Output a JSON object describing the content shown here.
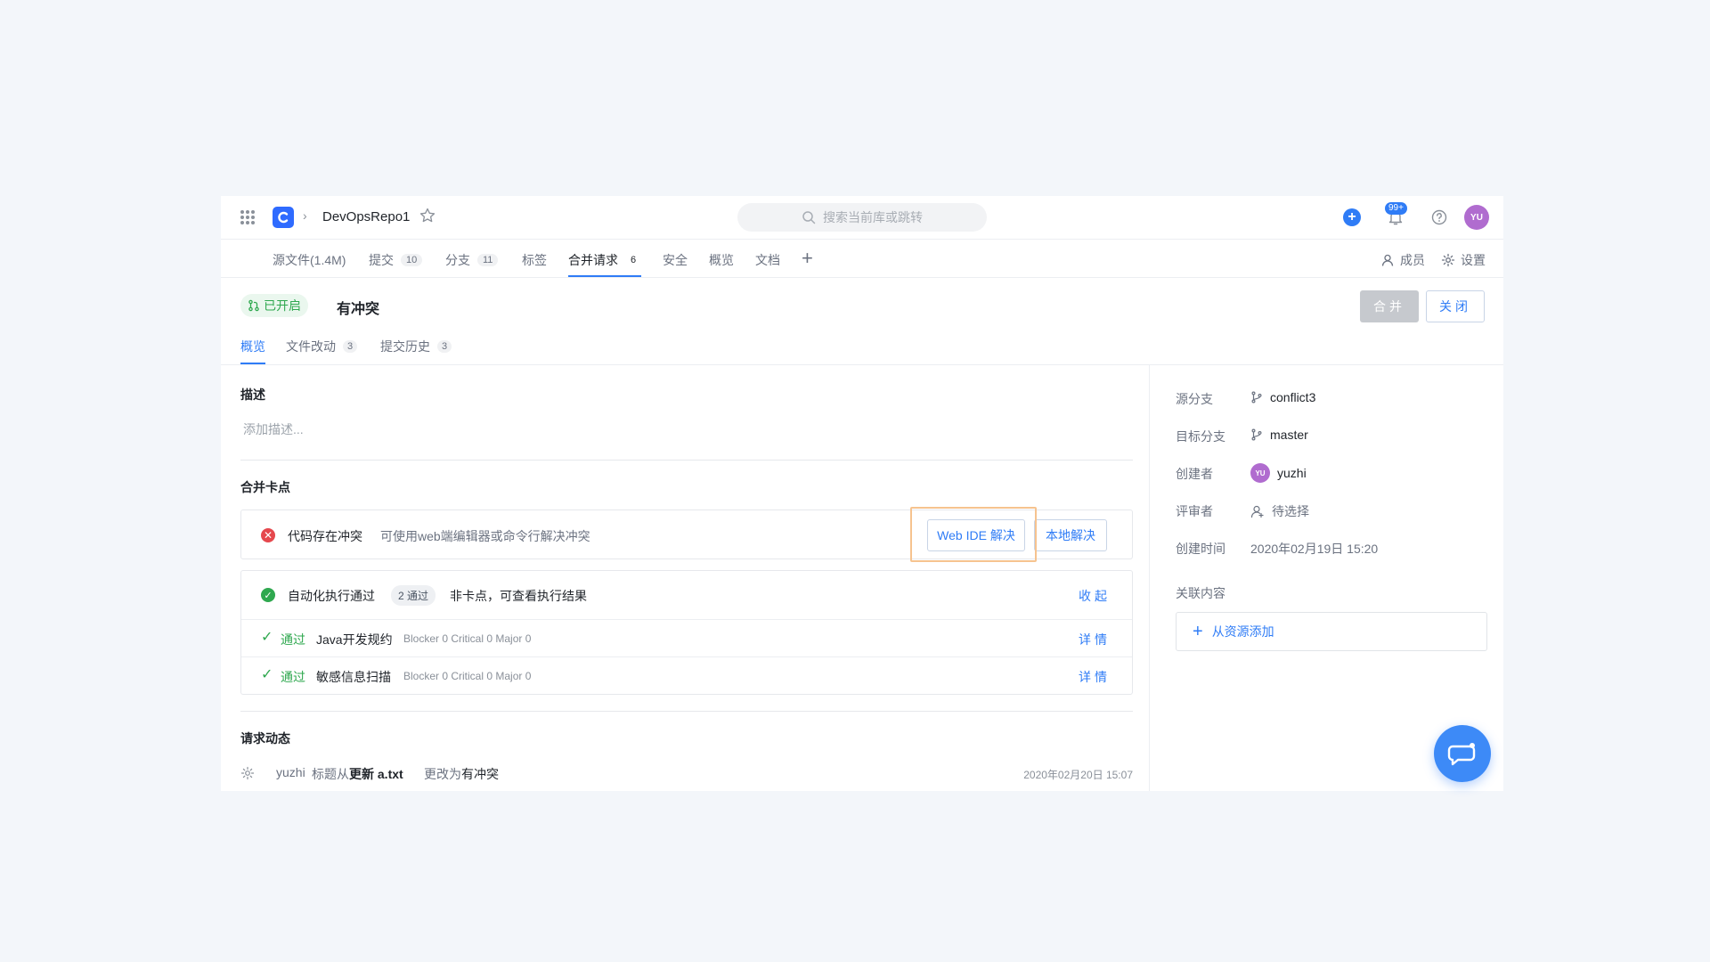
{
  "topbar": {
    "repo_name": "DevOpsRepo1",
    "search_placeholder": "搜索当前库或跳转",
    "notification_badge": "99+",
    "avatar_initials": "YU"
  },
  "nav": {
    "items": [
      {
        "label": "源文件(1.4M)",
        "count": ""
      },
      {
        "label": "提交",
        "count": "10"
      },
      {
        "label": "分支",
        "count": "11"
      },
      {
        "label": "标签",
        "count": ""
      },
      {
        "label": "合并请求",
        "count": "6"
      },
      {
        "label": "安全",
        "count": ""
      },
      {
        "label": "概览",
        "count": ""
      },
      {
        "label": "文档",
        "count": ""
      }
    ],
    "members_label": "成员",
    "settings_label": "设置"
  },
  "mr": {
    "status": "已开启",
    "title": "有冲突",
    "merge_label": "合并",
    "close_label": "关闭"
  },
  "subtabs": [
    {
      "label": "概览",
      "count": ""
    },
    {
      "label": "文件改动",
      "count": "3"
    },
    {
      "label": "提交历史",
      "count": "3"
    }
  ],
  "description": {
    "title": "描述",
    "placeholder": "添加描述..."
  },
  "checkpoints": {
    "title": "合并卡点",
    "conflict": {
      "label": "代码存在冲突",
      "hint": "可使用web端编辑器或命令行解决冲突",
      "webide_label": "Web IDE 解决",
      "local_label": "本地解决"
    },
    "automation": {
      "label": "自动化执行通过",
      "pill": "2 通过",
      "hint": "非卡点，可查看执行结果",
      "collapse_label": "收起",
      "rows": [
        {
          "status": "通过",
          "name": "Java开发规约",
          "detail": "Blocker 0 Critical 0 Major 0",
          "action": "详情"
        },
        {
          "status": "通过",
          "name": "敏感信息扫描",
          "detail": "Blocker 0 Critical 0 Major 0",
          "action": "详情"
        }
      ]
    }
  },
  "activity": {
    "title": "请求动态",
    "user": "yuzhi",
    "text_pre": "标题从",
    "old_title": "更新 a.txt",
    "text_mid": "更改为",
    "new_title": "有冲突",
    "time": "2020年02月20日 15:07"
  },
  "sidebar": {
    "source_branch_label": "源分支",
    "source_branch": "conflict3",
    "target_branch_label": "目标分支",
    "target_branch": "master",
    "creator_label": "创建者",
    "creator": "yuzhi",
    "creator_initials": "YU",
    "reviewer_label": "评审者",
    "reviewer": "待选择",
    "created_label": "创建时间",
    "created": "2020年02月19日 15:20",
    "related_label": "关联内容",
    "add_label": "从资源添加"
  },
  "colors": {
    "accent": "#2f7cf6",
    "success": "#2fa84f",
    "danger": "#e5484d",
    "highlight": "#f6c38f"
  }
}
